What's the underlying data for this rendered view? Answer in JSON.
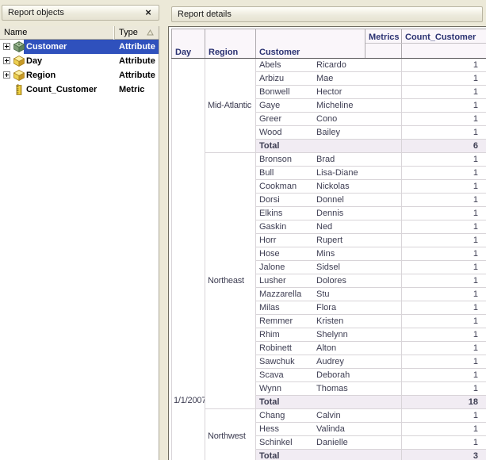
{
  "colors": {
    "selection_blue": "#2f51bd",
    "header_navy": "#2b3272",
    "total_navy": "#23307a"
  },
  "left_panel": {
    "title": "Report objects",
    "icons": {
      "close": "×"
    },
    "name_column": "Name",
    "type_column": "Type",
    "items": [
      {
        "label": "Customer",
        "type": "Attribute",
        "icon": "attribute-customer-icon",
        "expandable": true,
        "selected": true
      },
      {
        "label": "Day",
        "type": "Attribute",
        "icon": "attribute-icon",
        "expandable": true,
        "selected": false
      },
      {
        "label": "Region",
        "type": "Attribute",
        "icon": "attribute-icon",
        "expandable": true,
        "selected": false
      },
      {
        "label": "Count_Customer",
        "type": "Metric",
        "icon": "metric-icon",
        "expandable": false,
        "selected": false
      }
    ]
  },
  "right_panel": {
    "title": "Report details",
    "grid": {
      "row_headers": [
        "Day",
        "Region",
        "Customer"
      ],
      "metrics_axis_label": "Metrics",
      "metric_name": "Count_Customer",
      "total_label": "Total",
      "day_value": "1/1/2007",
      "groups": [
        {
          "region": "Mid-Atlantic",
          "customers": [
            [
              "Abels",
              "Ricardo",
              1
            ],
            [
              "Arbizu",
              "Mae",
              1
            ],
            [
              "Bonwell",
              "Hector",
              1
            ],
            [
              "Gaye",
              "Micheline",
              1
            ],
            [
              "Greer",
              "Cono",
              1
            ],
            [
              "Wood",
              "Bailey",
              1
            ]
          ],
          "total": 6
        },
        {
          "region": "Northeast",
          "customers": [
            [
              "Bronson",
              "Brad",
              1
            ],
            [
              "Bull",
              "Lisa-Diane",
              1
            ],
            [
              "Cookman",
              "Nickolas",
              1
            ],
            [
              "Dorsi",
              "Donnel",
              1
            ],
            [
              "Elkins",
              "Dennis",
              1
            ],
            [
              "Gaskin",
              "Ned",
              1
            ],
            [
              "Horr",
              "Rupert",
              1
            ],
            [
              "Hose",
              "Mins",
              1
            ],
            [
              "Jalone",
              "Sidsel",
              1
            ],
            [
              "Lusher",
              "Dolores",
              1
            ],
            [
              "Mazzarella",
              "Stu",
              1
            ],
            [
              "Milas",
              "Flora",
              1
            ],
            [
              "Remmer",
              "Kristen",
              1
            ],
            [
              "Rhim",
              "Shelynn",
              1
            ],
            [
              "Robinett",
              "Alton",
              1
            ],
            [
              "Sawchuk",
              "Audrey",
              1
            ],
            [
              "Scava",
              "Deborah",
              1
            ],
            [
              "Wynn",
              "Thomas",
              1
            ]
          ],
          "total": 18
        },
        {
          "region": "Northwest",
          "customers": [
            [
              "Chang",
              "Calvin",
              1
            ],
            [
              "Hess",
              "Valinda",
              1
            ],
            [
              "Schinkel",
              "Danielle",
              1
            ]
          ],
          "total": 3
        }
      ]
    }
  }
}
